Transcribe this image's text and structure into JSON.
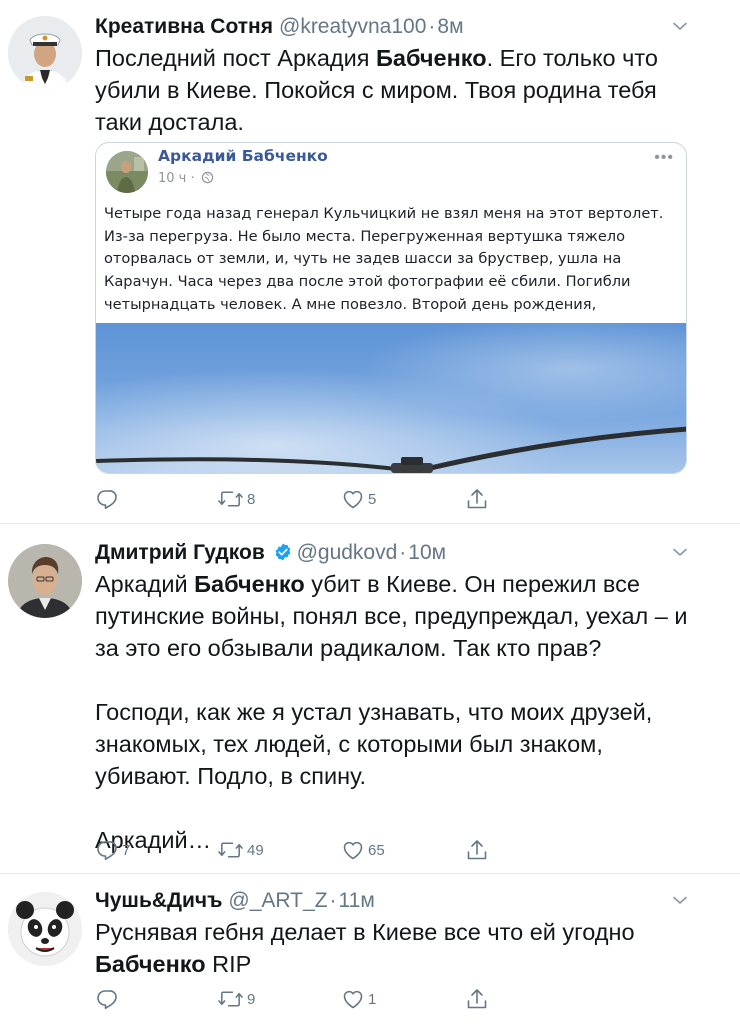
{
  "colors": {
    "text": "#14171a",
    "secondary": "#657786",
    "border": "#e6ecf0",
    "verified": "#1da1f2",
    "fb_blue": "#3b5998"
  },
  "tweets": [
    {
      "name": "Креативна Сотня",
      "handle": "@kreatyvna100",
      "sep": "·",
      "time": "8м",
      "text_lines": [
        "Последний пост Аркадия ",
        "Бабченко",
        ". Его только что убили в Киеве. Покойся с миром. Твоя родина тебя таки достала."
      ],
      "quoted": {
        "author": "Аркадий Бабченко",
        "time": "10 ч ·",
        "dots": "•••",
        "text": "Четыре года назад генерал Кульчицкий не взял меня на этот вертолет. Из-за перегруза. Не было места. Перегруженная вертушка тяжело оторвалась от земли, и, чуть не задев шасси за бруствер, ушла на Карачун. Часа через два после этой фотографии её сбили. Погибли четырнадцать человек. А мне повезло. Второй день рождения, получается."
      },
      "actions": {
        "reply": "",
        "retweet": "8",
        "like": "5"
      }
    },
    {
      "name": "Дмитрий Гудков",
      "verified": true,
      "handle": "@gudkovd",
      "sep": "·",
      "time": "10м",
      "p1": [
        "Аркадий ",
        "Бабченко",
        " убит в Киеве. Он пережил все путинские войны, понял все, предупреждал, уехал – и за это его обзывали радикалом. Так кто прав?"
      ],
      "p2": "Господи, как же я устал узнавать, что моих друзей, знакомых, тех людей, с которыми был знаком, убивают. Подло, в спину.",
      "p3": "Аркадий…",
      "actions": {
        "reply": "7",
        "retweet": "49",
        "like": "65"
      }
    },
    {
      "name": "Чушь&Дичъ",
      "handle": "@_ART_Z",
      "sep": "·",
      "time": "11м",
      "line1": "Руснявая гебня делает в Киеве все что ей угодно",
      "line2_bold": "Бабченко",
      "line2_rest": " RIP",
      "actions": {
        "reply": "",
        "retweet": "9",
        "like": "1"
      }
    }
  ]
}
